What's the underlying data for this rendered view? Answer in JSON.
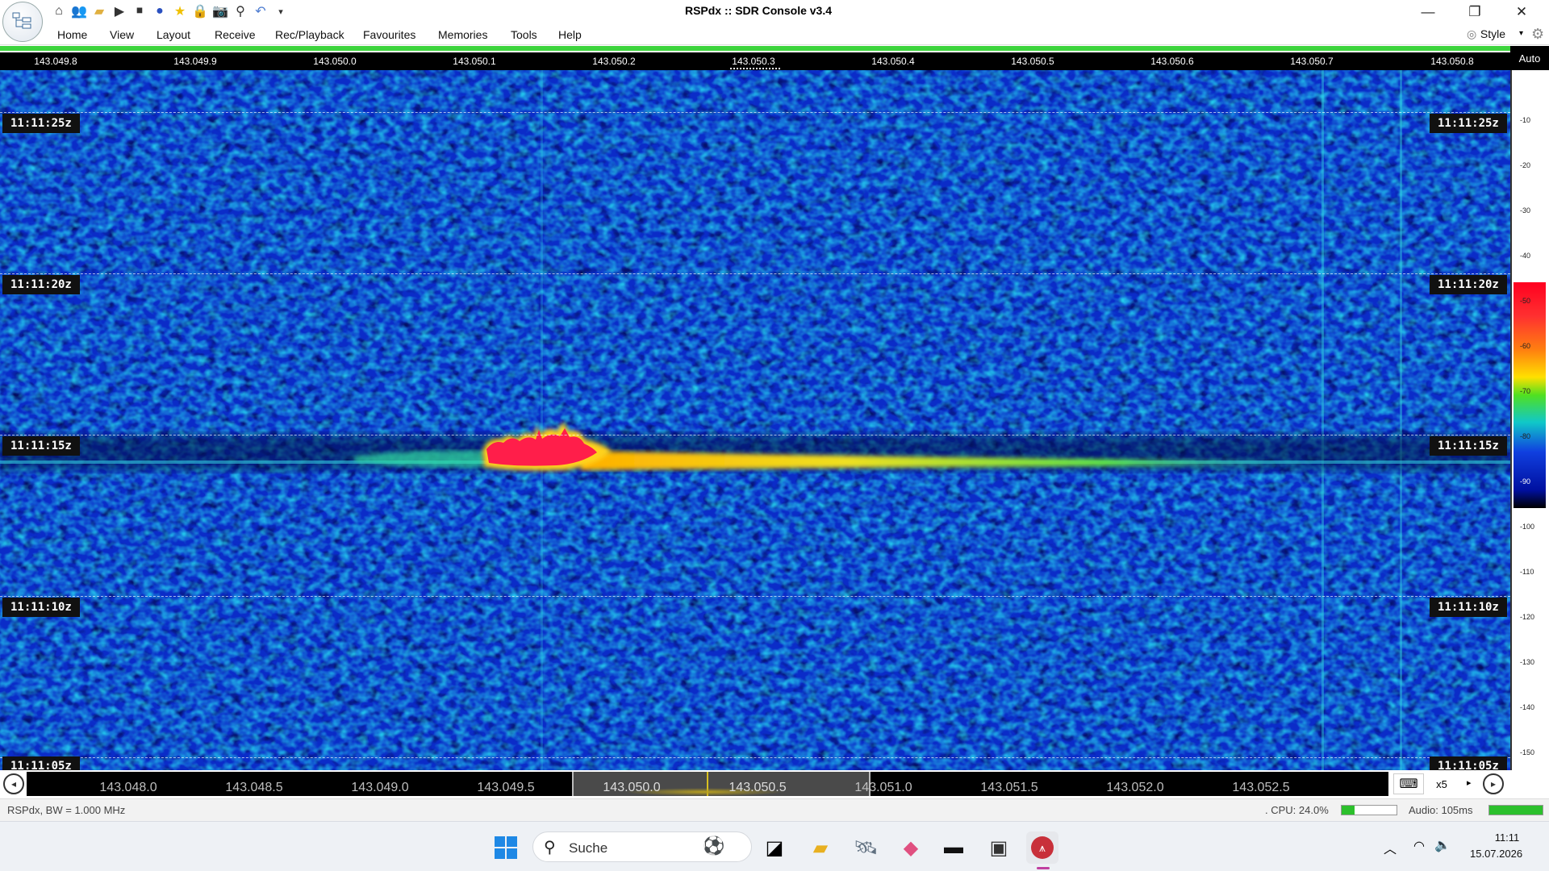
{
  "window": {
    "title": "RSPdx :: SDR Console v3.4",
    "controls": [
      "minimize-icon",
      "restore-icon",
      "close-icon"
    ]
  },
  "quick_access": [
    "home-icon",
    "users-icon",
    "folder-icon",
    "play-icon",
    "stop-icon",
    "record-icon",
    "star-icon",
    "lock-icon",
    "camera-icon",
    "satellite-icon",
    "undo-icon",
    "dropdown-icon"
  ],
  "menu": {
    "items": [
      "Home",
      "View",
      "Layout",
      "Receive",
      "Rec/Playback",
      "Favourites",
      "Memories",
      "Tools",
      "Help"
    ],
    "style_label": "Style"
  },
  "top_scale": {
    "labels": [
      "143.049.8",
      "143.049.9",
      "143.050.0",
      "143.050.1",
      "143.050.2",
      "143.050.3",
      "143.050.4",
      "143.050.5",
      "143.050.6",
      "143.050.7",
      "143.050.8"
    ],
    "auto_label": "Auto"
  },
  "waterfall": {
    "time_labels": [
      "11:11:25z",
      "11:11:20z",
      "11:11:15z",
      "11:11:10z",
      "11:11:05z"
    ],
    "signal_color_strong": "#ff1e4a",
    "signal_color_mid": "#ffd21e",
    "noise_base": "#0a2fd0"
  },
  "level_legend": {
    "labels": [
      "-10",
      "-20",
      "-30",
      "-40",
      "-50",
      "-60",
      "-70",
      "-80",
      "-90",
      "-100",
      "-110",
      "-120",
      "-130",
      "-140",
      "-150"
    ]
  },
  "bottom_scale": {
    "labels": [
      "143.048.0",
      "143.048.5",
      "143.049.0",
      "143.049.5",
      "143.050.0",
      "143.050.5",
      "143.051.0",
      "143.051.5",
      "143.052.0",
      "143.052.5"
    ],
    "zoom_label": "x5"
  },
  "status": {
    "left": "RSPdx, BW = 1.000 MHz",
    "cpu": ". CPU: 24.0%",
    "cpu_fraction": 0.24,
    "audio": "Audio: 105ms",
    "audio_fraction": 1.0
  },
  "taskbar": {
    "search_placeholder": "Suche",
    "time": "11:11",
    "date": "15.07.2026"
  }
}
